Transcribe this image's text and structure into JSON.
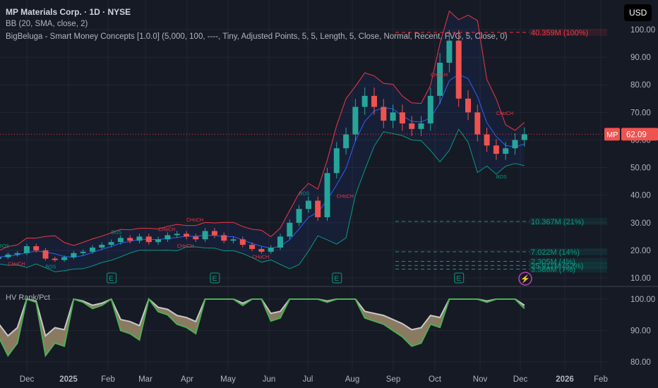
{
  "header": {
    "title": "MP Materials Corp. · 1D · NYSE",
    "bb": "BB (20, SMA, close, 2)",
    "smc": "BigBeluga - Smart Money Concepts [1.0.0] (5,000, 100, ----, Tiny, Adjusted Points, 5, 5, Length, 5, Close, Normal, Recent, FVG, 5, Close, 0)",
    "currency": "USD"
  },
  "colors": {
    "bg": "#161a25",
    "up": "#26a69a",
    "down": "#ef5350",
    "bb_mid": "#2962ff",
    "bb_upper": "#f23645",
    "bb_lower": "#089981",
    "hv_green": "#4caf50",
    "hv_white": "#c8c8c8",
    "hv_fill": "#8a7a62"
  },
  "chart_data": [
    {
      "type": "candlestick",
      "title": "MP Materials Corp. · 1D · NYSE",
      "ylabel": "USD",
      "ylim": [
        8,
        103
      ],
      "yticks": [
        "100.00",
        "90.00",
        "80.00",
        "70.00",
        "60.00",
        "50.00",
        "40.00",
        "30.00",
        "20.00",
        "10.00"
      ],
      "xticks": [
        "Dec",
        "2025",
        "Feb",
        "Mar",
        "Apr",
        "May",
        "Jun",
        "Jul",
        "Aug",
        "Sep",
        "Oct",
        "Nov",
        "Dec",
        "2026",
        "Feb"
      ],
      "last_price": {
        "symbol": "MP",
        "value": "62.09"
      },
      "closes": [
        17.5,
        18.5,
        19,
        21.5,
        20,
        17,
        16.5,
        17.5,
        19,
        19.5,
        21,
        22,
        23,
        24.5,
        23.5,
        25,
        23,
        24,
        25.5,
        26,
        25,
        24,
        27,
        25.5,
        23.5,
        24,
        22,
        20.5,
        19.5,
        21,
        25,
        30,
        35,
        38,
        32,
        48,
        57,
        62,
        72,
        76,
        72,
        67,
        70,
        66,
        64,
        66,
        76,
        88,
        96,
        75,
        70,
        62,
        58,
        55,
        57,
        60,
        62.09
      ],
      "liquidity_levels": [
        {
          "label": "40.359M (100%)",
          "price": 99,
          "color": "#f23645"
        },
        {
          "label": "10.367M (21%)",
          "price": 30.5,
          "color": "#089981"
        },
        {
          "label": "7.022M (14%)",
          "price": 19.5,
          "color": "#089981"
        },
        {
          "label": "2.305M (4%)",
          "price": 16,
          "color": "#089981"
        },
        {
          "label": "25.911M (52%)",
          "price": 14.5,
          "color": "#089981"
        },
        {
          "label": "3.586M (7%)",
          "price": 13.2,
          "color": "#089981"
        }
      ],
      "structure_labels": [
        {
          "text": "BOS",
          "week": 0,
          "price": 21
        },
        {
          "text": "CHoCH",
          "week": 1,
          "price": 14.5
        },
        {
          "text": "BOS",
          "week": 5,
          "price": 13.5
        },
        {
          "text": "BOS",
          "week": 12,
          "price": 26
        },
        {
          "text": "CHoCH",
          "week": 17,
          "price": 27
        },
        {
          "text": "CHoCH",
          "week": 19,
          "price": 21
        },
        {
          "text": "CHoCH",
          "week": 27,
          "price": 17
        },
        {
          "text": "CHoCH",
          "week": 20,
          "price": 30.5
        },
        {
          "text": "BOS",
          "week": 32,
          "price": 40
        },
        {
          "text": "CHoCH",
          "week": 36,
          "price": 39
        },
        {
          "text": "CHoCH",
          "week": 46,
          "price": 83
        },
        {
          "text": "CHoCH",
          "week": 53,
          "price": 69
        },
        {
          "text": "BOS",
          "week": 53,
          "price": 46
        }
      ],
      "earnings_weeks": [
        12,
        23,
        36,
        49
      ]
    },
    {
      "type": "area",
      "title": "HV Rank/Pct",
      "ylim": [
        77,
        103
      ],
      "yticks": [
        "100.00",
        "90.00",
        "80.00"
      ],
      "pct": [
        88,
        82,
        86,
        100,
        99,
        82,
        86,
        85,
        100,
        99,
        97,
        98,
        100,
        90,
        89,
        87,
        100,
        96,
        95,
        92,
        91,
        89,
        100,
        100,
        100,
        100,
        98,
        100,
        100,
        93,
        94,
        100,
        100,
        100,
        100,
        99,
        100,
        100,
        100,
        94,
        93,
        92,
        90,
        88,
        85,
        86,
        92,
        91,
        100,
        100,
        100,
        100,
        99,
        100,
        100,
        100,
        97
      ]
    }
  ]
}
